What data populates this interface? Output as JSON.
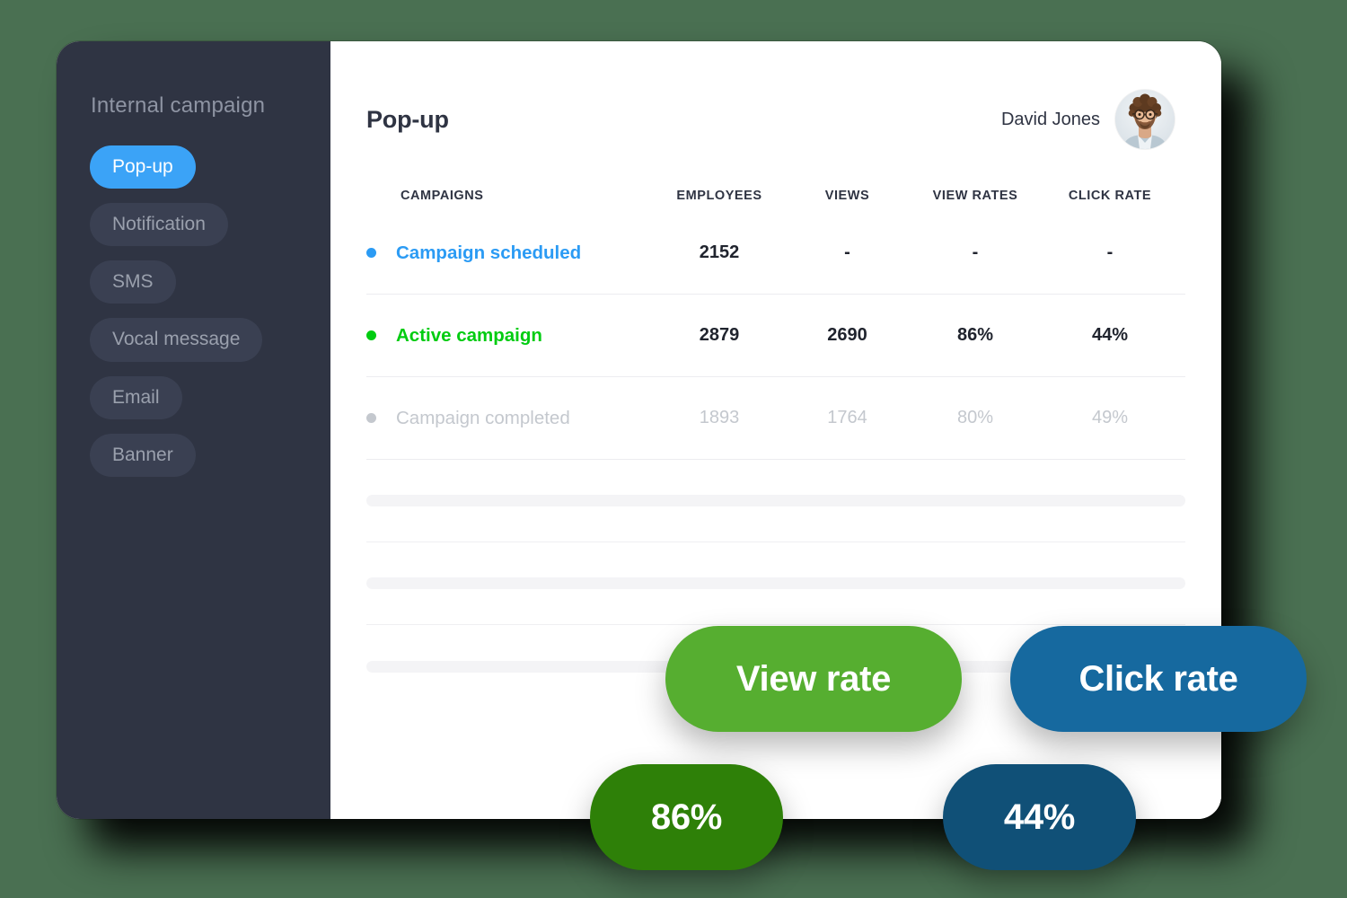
{
  "sidebar": {
    "title": "Internal campaign",
    "items": [
      {
        "label": "Pop-up",
        "active": true
      },
      {
        "label": "Notification",
        "active": false
      },
      {
        "label": "SMS",
        "active": false
      },
      {
        "label": "Vocal message",
        "active": false
      },
      {
        "label": "Email",
        "active": false
      },
      {
        "label": "Banner",
        "active": false
      }
    ]
  },
  "header": {
    "title": "Pop-up",
    "user_name": "David Jones",
    "avatar_icon": "user-photo-avatar"
  },
  "table": {
    "columns": [
      "CAMPAIGNS",
      "EMPLOYEES",
      "VIEWS",
      "VIEW RATES",
      "CLICK RATE"
    ],
    "rows": [
      {
        "status_icon": "status-dot-scheduled",
        "campaign": "Campaign scheduled",
        "employees": "2152",
        "views": "-",
        "view_rates": "-",
        "click_rate": "-",
        "color": "#2b9bf4"
      },
      {
        "status_icon": "status-dot-active",
        "campaign": "Active campaign",
        "employees": "2879",
        "views": "2690",
        "view_rates": "86%",
        "click_rate": "44%",
        "color": "#00cc11"
      },
      {
        "status_icon": "status-dot-completed",
        "campaign": "Campaign completed",
        "employees": "1893",
        "views": "1764",
        "view_rates": "80%",
        "click_rate": "49%",
        "color": "#c4c8ce"
      }
    ]
  },
  "callouts": {
    "view_rate_label": "View rate",
    "view_rate_value": "86%",
    "click_rate_label": "Click rate",
    "click_rate_value": "44%"
  },
  "colors": {
    "page_background": "#4a7052",
    "sidebar_background": "#2f3443",
    "accent_blue": "#3ba3f7",
    "pill_inactive": "#3a4052",
    "status_scheduled": "#2b9bf4",
    "status_active": "#00cc11",
    "status_completed": "#c4c8ce",
    "callout_view_rate": "#56ae30",
    "callout_click_rate": "#16699f",
    "badge_view_rate": "#2e8008",
    "badge_click_rate": "#105077"
  }
}
